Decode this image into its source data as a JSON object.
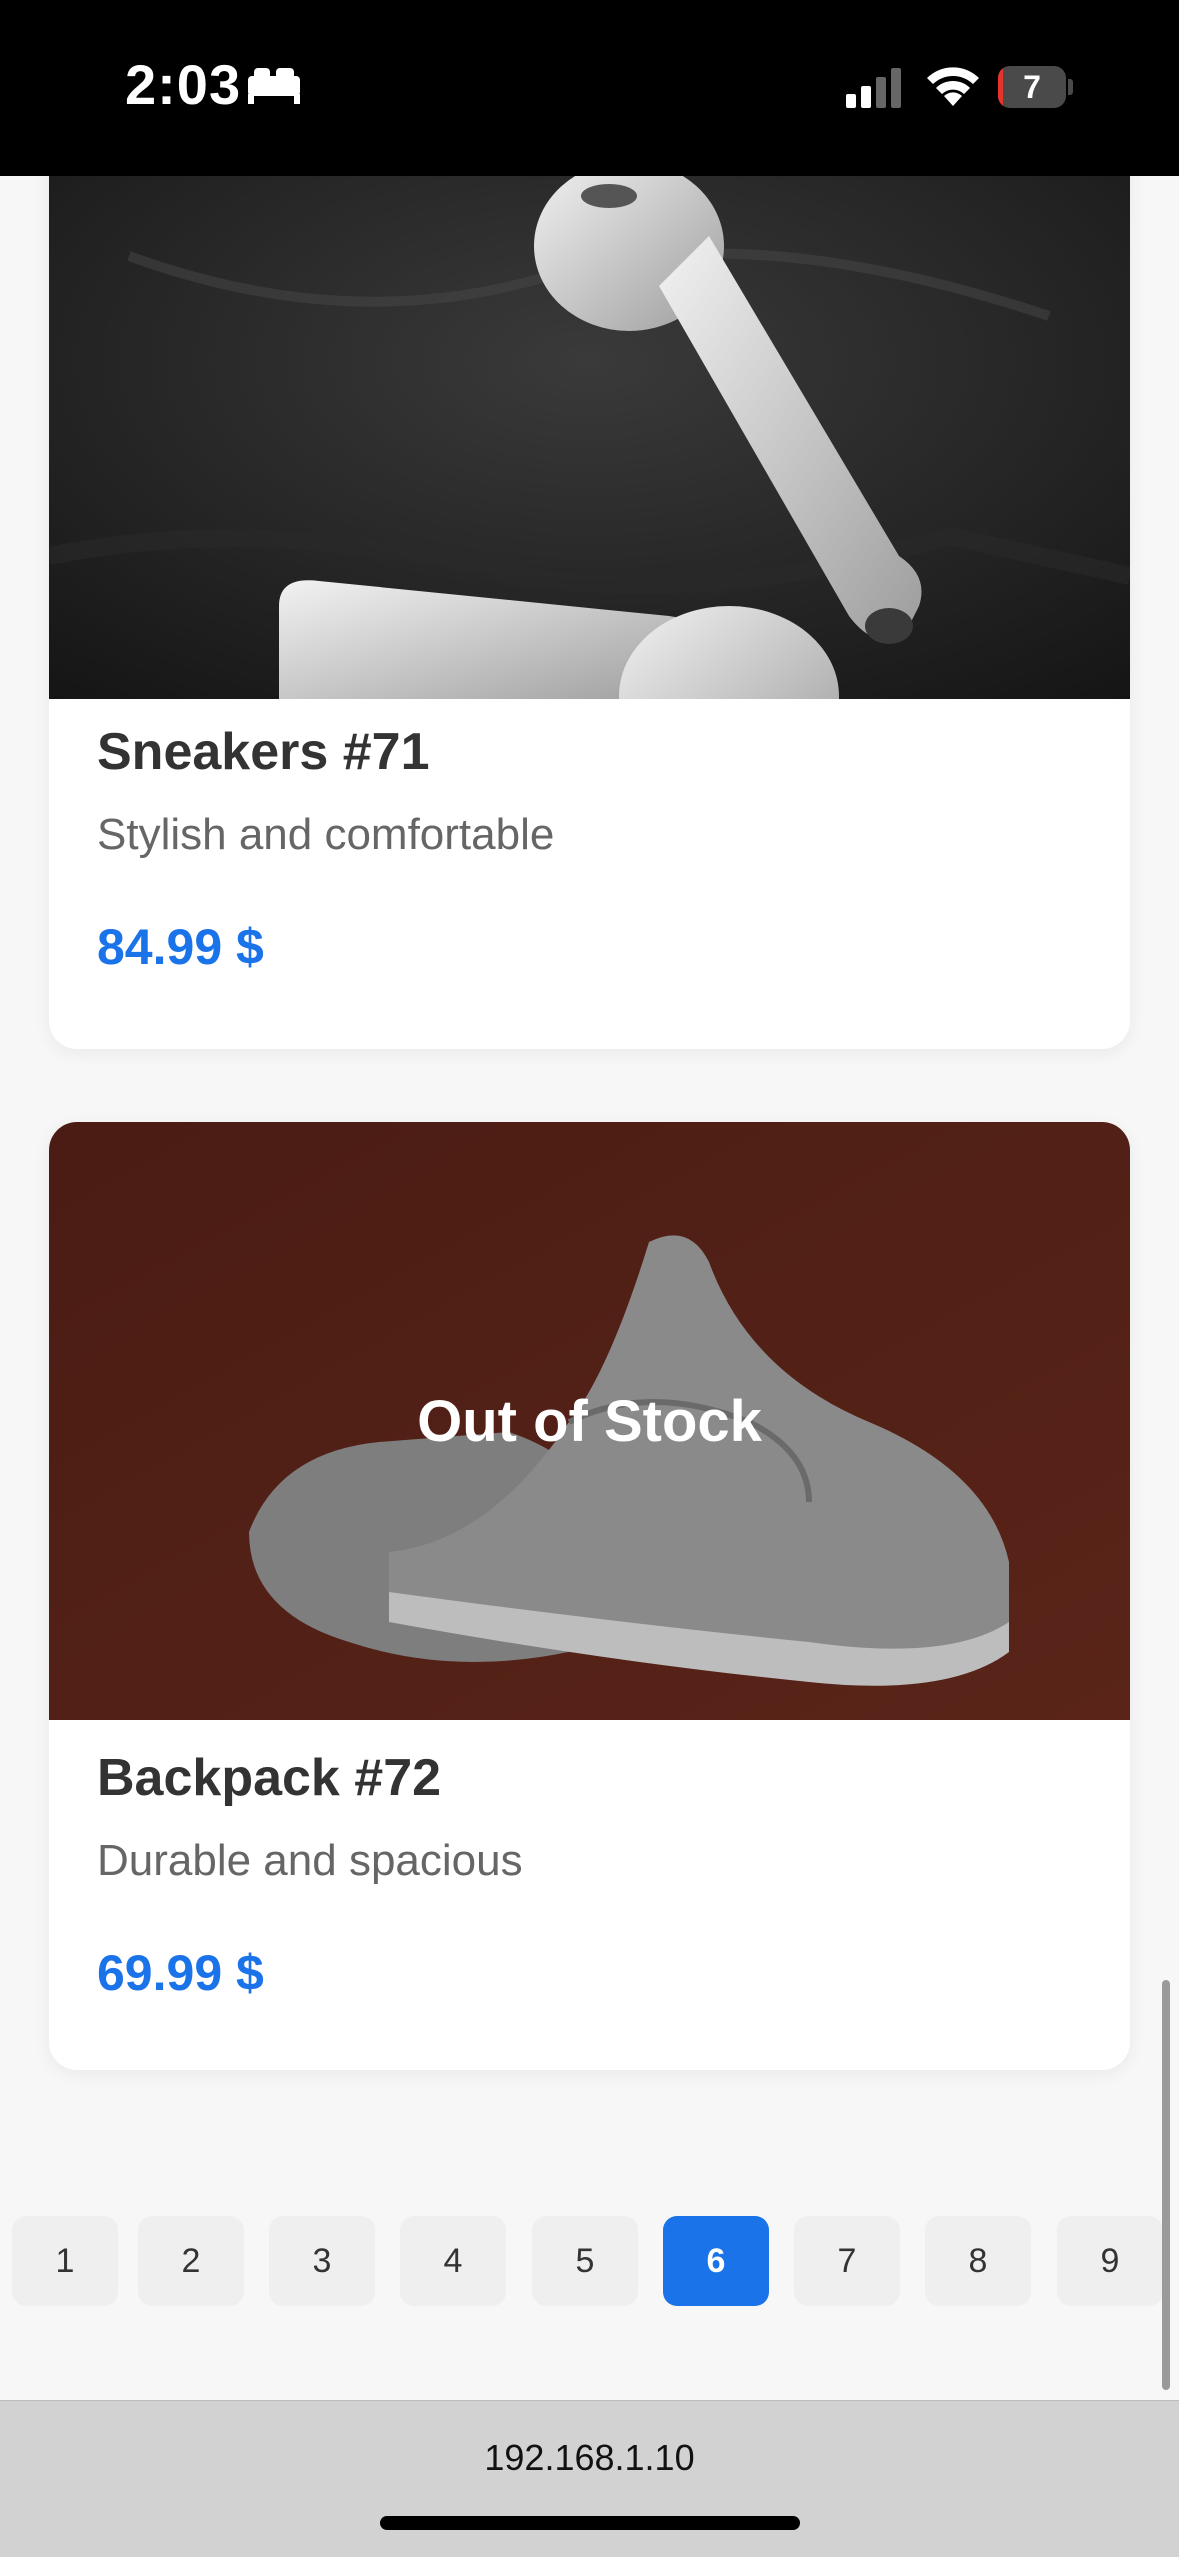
{
  "status_bar": {
    "time": "2:03",
    "battery_level": "7",
    "battery_fill_percent": 7,
    "icons": [
      "sleep-icon",
      "cellular-signal-icon",
      "wifi-icon",
      "battery-icon"
    ]
  },
  "products": [
    {
      "name": "Sneakers #71",
      "description": "Stylish and comfortable",
      "price": "84.99 $",
      "image": "earbuds-photo",
      "out_of_stock": false
    },
    {
      "name": "Backpack #72",
      "description": "Durable and spacious",
      "price": "69.99 $",
      "image": "sneakers-photo",
      "out_of_stock": true,
      "overlay_text": "Out of Stock"
    }
  ],
  "pagination": {
    "pages": [
      "1",
      "2",
      "3",
      "4",
      "5",
      "6",
      "7",
      "8",
      "9"
    ],
    "current": "6"
  },
  "url_bar": {
    "address": "192.168.1.10"
  },
  "colors": {
    "accent": "#1a73e8",
    "price": "#1a73e8",
    "battery_low": "#e5342b"
  }
}
